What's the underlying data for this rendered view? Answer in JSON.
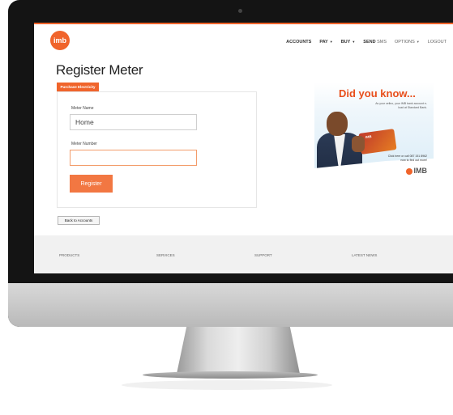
{
  "logo": {
    "text": "imb"
  },
  "nav": {
    "accounts": "ACCOUNTS",
    "pay": "PAY",
    "buy": "BUY",
    "send_sms_bold": "SEND",
    "send_sms_light": "SMS",
    "options": "OPTIONS",
    "logout": "LOGOUT"
  },
  "page": {
    "title": "Register Meter",
    "tab": "Purchase Electricity",
    "meter_name_label": "Meter Name",
    "meter_name_value": "Home",
    "meter_number_label": "Meter Number",
    "meter_number_value": "",
    "register_button": "Register",
    "back_button": "Back to Accounts"
  },
  "ad": {
    "headline": "Did you know...",
    "sub": "As your cellno, your IMB bank account e-load at Standard Bank.",
    "card_text": "IMB",
    "cta": "Click here or call 087 151 8962 now to find out more!",
    "brand": "IMB"
  },
  "footer": {
    "products": "PRODUCTS",
    "services": "SERVICES",
    "support": "SUPPORT",
    "latest_news": "LATEST NEWS"
  },
  "colors": {
    "brand_orange": "#f0642b",
    "button_orange": "#f27742"
  }
}
